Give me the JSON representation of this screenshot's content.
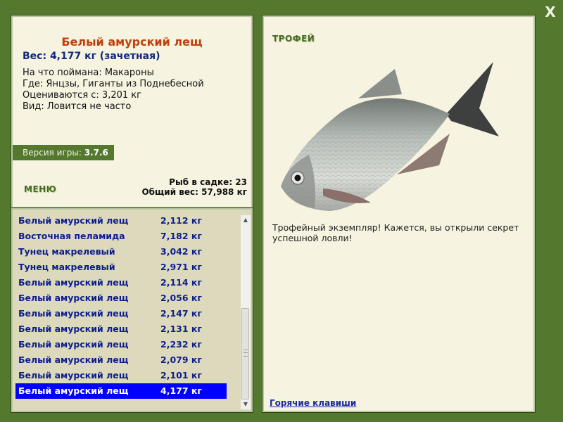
{
  "close_label": "X",
  "fish": {
    "name": "Белый амурский лещ",
    "weight_line": "Вес: 4,177 кг (зачетная)",
    "bait_line": "На что поймана: Макароны",
    "place_line": "Где: Янцзы, Гиганты из Поднебесной",
    "valued_line": "Оцениваются с: 3,201 кг",
    "kind_line": "Вид: Ловится не часто"
  },
  "version": {
    "label": "Версия игры:",
    "value": "3.7.6"
  },
  "menu_label": "МЕНЮ",
  "stats": {
    "count_line": "Рыб в садке: 23",
    "total_line": "Общий вес: 57,988 кг"
  },
  "catch_list": [
    {
      "name": "Белый амурский лещ",
      "weight": "2,112 кг"
    },
    {
      "name": "Восточная пеламида",
      "weight": "7,182 кг"
    },
    {
      "name": "Тунец макрелевый",
      "weight": "3,042 кг"
    },
    {
      "name": "Тунец макрелевый",
      "weight": "2,971 кг"
    },
    {
      "name": "Белый амурский лещ",
      "weight": "2,114 кг"
    },
    {
      "name": "Белый амурский лещ",
      "weight": "2,056 кг"
    },
    {
      "name": "Белый амурский лещ",
      "weight": "2,147 кг"
    },
    {
      "name": "Белый амурский лещ",
      "weight": "2,131 кг"
    },
    {
      "name": "Белый амурский лещ",
      "weight": "2,232 кг"
    },
    {
      "name": "Белый амурский лещ",
      "weight": "2,079 кг"
    },
    {
      "name": "Белый амурский лещ",
      "weight": "2,101 кг"
    },
    {
      "name": "Белый амурский лещ",
      "weight": "4,177 кг",
      "selected": true
    }
  ],
  "trophy": {
    "label": "ТРОФЕЙ",
    "text": "Трофейный экземпляр! Кажется, вы открыли секрет успешной ловли!"
  },
  "hotkeys_link": "Горячие клавиши",
  "colors": {
    "frame": "#53782e",
    "panel": "#f6f3e0",
    "list_bg": "#ddd9bd",
    "name_color": "#c0400c",
    "list_text": "#0d1f8c",
    "selection": "#0000ff"
  }
}
